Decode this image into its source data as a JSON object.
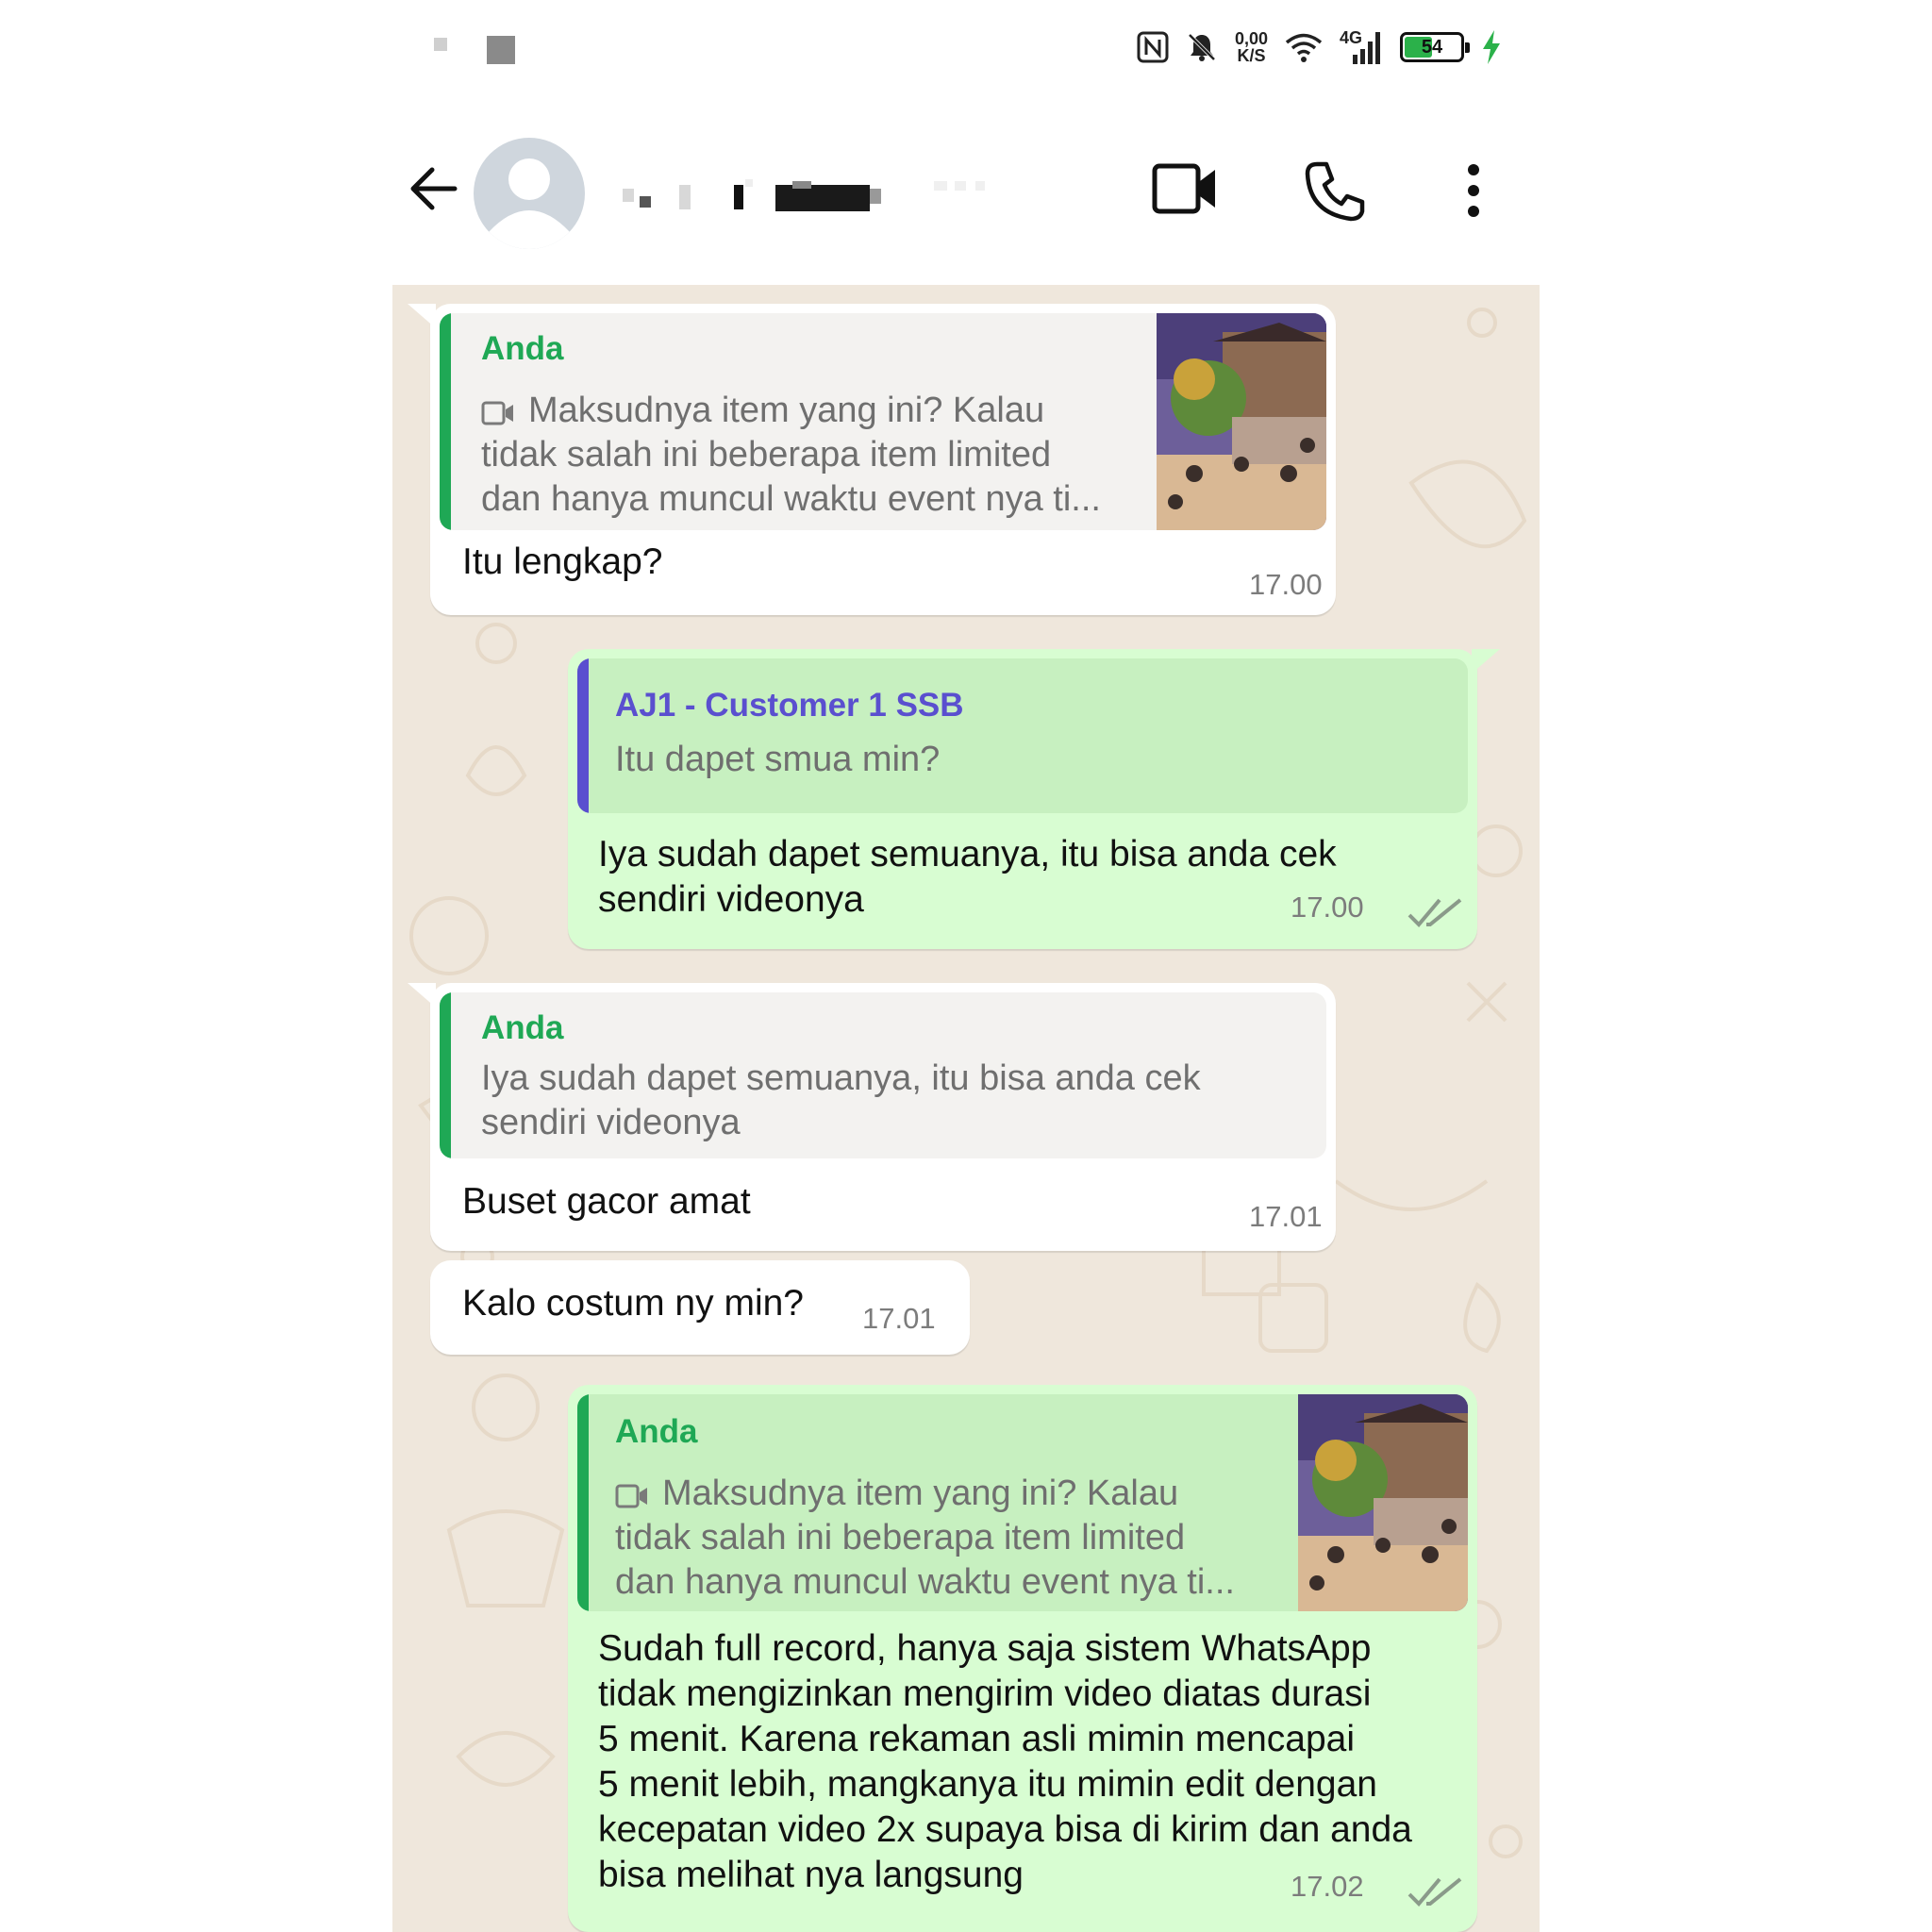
{
  "status_bar": {
    "net_speed_value": "0,00",
    "net_speed_unit": "K/S",
    "network_type": "4G",
    "battery_level": "54",
    "battery_fraction": 0.54
  },
  "header": {
    "contact_name_blurred": true
  },
  "colors": {
    "chat_background": "#efe7dc",
    "incoming_bubble": "#ffffff",
    "outgoing_bubble": "#d8fdd2",
    "self_author": "#1fa855",
    "other_author": "#5a4fcf",
    "read_ticks": "#8a9a8a"
  },
  "messages": [
    {
      "direction": "incoming",
      "quote": {
        "author": "Anda",
        "lines": [
          "Maksudnya item yang ini? Kalau",
          "tidak salah ini beberapa item limited",
          "dan hanya muncul waktu event nya ti..."
        ],
        "has_video_icon": true,
        "has_thumbnail": true
      },
      "lines": [
        "Itu lengkap?"
      ],
      "time": "17.00"
    },
    {
      "direction": "outgoing",
      "quote": {
        "author": "AJ1 - Customer 1 SSB",
        "lines": [
          "Itu dapet smua min?"
        ]
      },
      "lines": [
        "Iya sudah dapet semuanya, itu bisa anda cek",
        "sendiri videonya"
      ],
      "time": "17.00",
      "status": "read"
    },
    {
      "direction": "incoming",
      "quote": {
        "author": "Anda",
        "lines": [
          "Iya sudah dapet semuanya, itu bisa anda cek",
          "sendiri videonya"
        ]
      },
      "lines": [
        "Buset gacor amat"
      ],
      "time": "17.01"
    },
    {
      "direction": "incoming",
      "lines": [
        "Kalo costum ny min?"
      ],
      "time": "17.01"
    },
    {
      "direction": "outgoing",
      "quote": {
        "author": "Anda",
        "lines": [
          "Maksudnya item yang ini? Kalau",
          "tidak salah ini beberapa item limited",
          "dan hanya muncul waktu event nya ti..."
        ],
        "has_video_icon": true,
        "has_thumbnail": true
      },
      "lines": [
        "Sudah full record, hanya saja sistem WhatsApp",
        "tidak mengizinkan mengirim video diatas durasi",
        "5 menit. Karena rekaman asli mimin mencapai",
        "5 menit lebih, mangkanya itu mimin edit dengan",
        "kecepatan video 2x supaya bisa di kirim dan anda",
        "bisa melihat nya langsung"
      ],
      "time": "17.02",
      "status": "read"
    }
  ],
  "icons": {
    "back": "arrow-left-icon",
    "video_call": "video-camera-icon",
    "voice_call": "phone-icon",
    "menu": "more-vertical-icon"
  }
}
